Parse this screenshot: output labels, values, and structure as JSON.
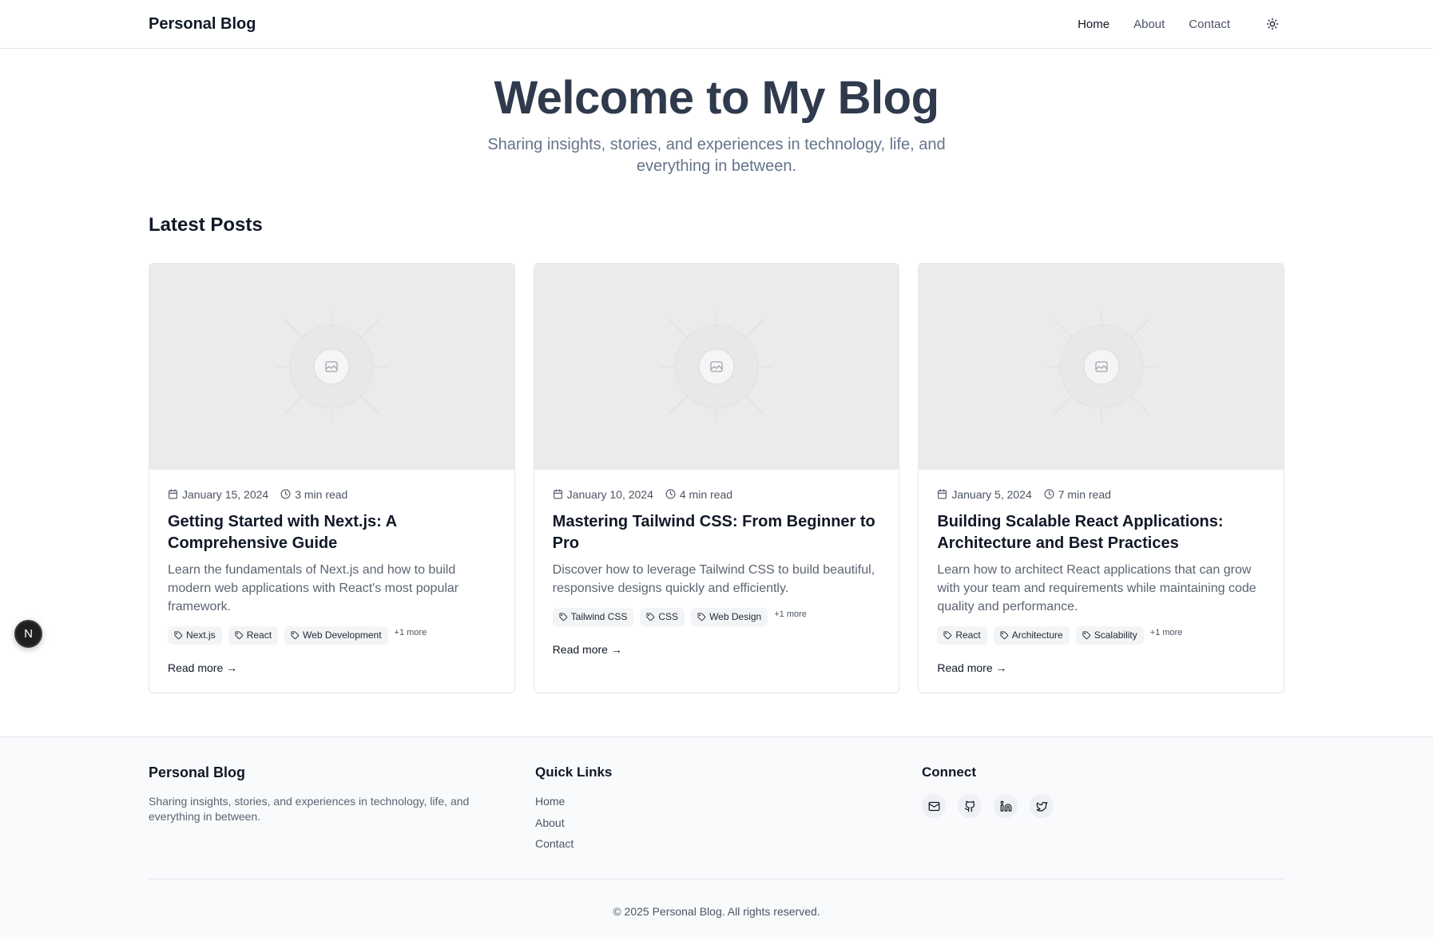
{
  "header": {
    "brand": "Personal Blog",
    "nav": [
      {
        "label": "Home",
        "active": true
      },
      {
        "label": "About",
        "active": false
      },
      {
        "label": "Contact",
        "active": false
      }
    ],
    "theme_toggle_icon": "sun-icon"
  },
  "hero": {
    "title": "Welcome to My Blog",
    "subtitle": "Sharing insights, stories, and experiences in technology, life, and everything in between."
  },
  "latest_posts": {
    "title": "Latest Posts",
    "posts": [
      {
        "date": "January 15, 2024",
        "read_time": "3 min read",
        "title": "Getting Started with Next.js: A Comprehensive Guide",
        "excerpt": "Learn the fundamentals of Next.js and how to build modern web applications with React's most popular framework.",
        "tags": [
          "Next.js",
          "React",
          "Web Development"
        ],
        "more": "+1 more",
        "read_more": "Read more →"
      },
      {
        "date": "January 10, 2024",
        "read_time": "4 min read",
        "title": "Mastering Tailwind CSS: From Beginner to Pro",
        "excerpt": "Discover how to leverage Tailwind CSS to build beautiful, responsive designs quickly and efficiently.",
        "tags": [
          "Tailwind CSS",
          "CSS",
          "Web Design"
        ],
        "more": "+1 more",
        "read_more": "Read more →"
      },
      {
        "date": "January 5, 2024",
        "read_time": "7 min read",
        "title": "Building Scalable React Applications: Architecture and Best Practices",
        "excerpt": "Learn how to architect React applications that can grow with your team and requirements while maintaining code quality and performance.",
        "tags": [
          "React",
          "Architecture",
          "Scalability"
        ],
        "more": "+1 more",
        "read_more": "Read more →"
      }
    ]
  },
  "floating_badge": "N",
  "footer": {
    "brand": "Personal Blog",
    "description": "Sharing insights, stories, and experiences in technology, life, and everything in between.",
    "quick_links_title": "Quick Links",
    "quick_links": [
      "Home",
      "About",
      "Contact"
    ],
    "connect_title": "Connect",
    "socials": [
      "mail-icon",
      "github-icon",
      "linkedin-icon",
      "twitter-icon"
    ],
    "copyright": "© 2025 Personal Blog. All rights reserved."
  },
  "colors": {
    "text_primary": "#111827",
    "text_muted": "#4b5563",
    "hero_title": "#2f3a4d",
    "image_placeholder": "#ebebeb",
    "tag_bg": "#f3f4f6",
    "footer_bg": "#f8fafc"
  }
}
